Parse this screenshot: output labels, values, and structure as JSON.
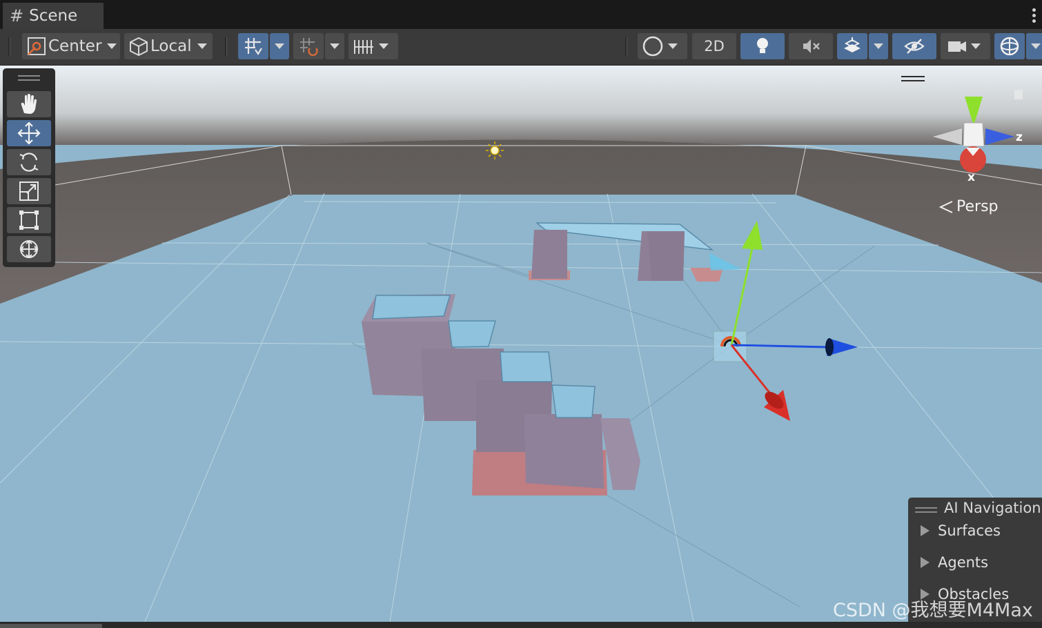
{
  "window": {
    "tab_title": "Scene"
  },
  "toolbar": {
    "pivot_label": "Center",
    "space_label": "Local",
    "mode_2d_label": "2D"
  },
  "viewport": {
    "projection_label": "Persp",
    "gizmo_axes": {
      "x": "x",
      "z": "z"
    }
  },
  "tools": [
    "hand-tool",
    "move-tool",
    "rotate-tool",
    "scale-tool",
    "rect-tool",
    "transform-tool"
  ],
  "overlay": {
    "title": "AI Navigation",
    "items": [
      {
        "label": "Surfaces"
      },
      {
        "label": "Agents"
      },
      {
        "label": "Obstacles"
      }
    ]
  },
  "watermark": "CSDN @我想要M4Max",
  "colors": {
    "toolbar_bg": "#3a3a3a",
    "active_button": "#4d6e98",
    "ground": "#8fb6cc",
    "geometry": "#8f7f96",
    "axis_x": "#d9302a",
    "axis_y": "#8ee02c",
    "axis_z": "#1f4fe0"
  }
}
